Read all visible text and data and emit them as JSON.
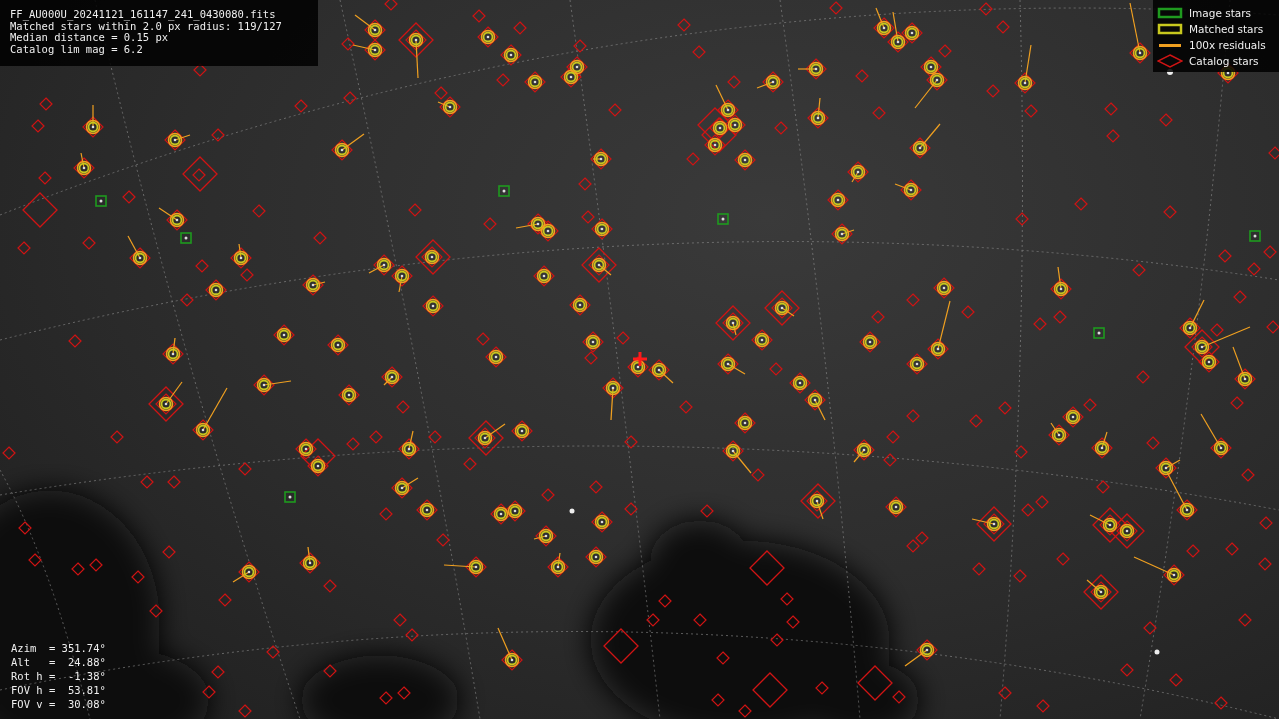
{
  "header": {
    "lines": [
      "FF_AU000U_20241121_161147_241_0430080.fits",
      "Matched stars within 2.0 px radius: 119/127",
      "Median distance = 0.15 px",
      "Catalog lim mag = 6.2"
    ]
  },
  "legend": [
    {
      "label": "Image stars",
      "kind": "image",
      "color": "#1f9a1f"
    },
    {
      "label": "Matched stars",
      "kind": "matched",
      "color": "#c8c81e"
    },
    {
      "label": "100x residuals",
      "kind": "residual",
      "color": "#f0a020"
    },
    {
      "label": "Catalog stars",
      "kind": "catalog",
      "color": "#d01414"
    }
  ],
  "info": {
    "lines": [
      "Azim  = 351.74°",
      "Alt   =  24.88°",
      "Rot h =  -1.38°",
      "FOV h =  53.81°",
      "FOV v =  30.08°"
    ]
  }
}
